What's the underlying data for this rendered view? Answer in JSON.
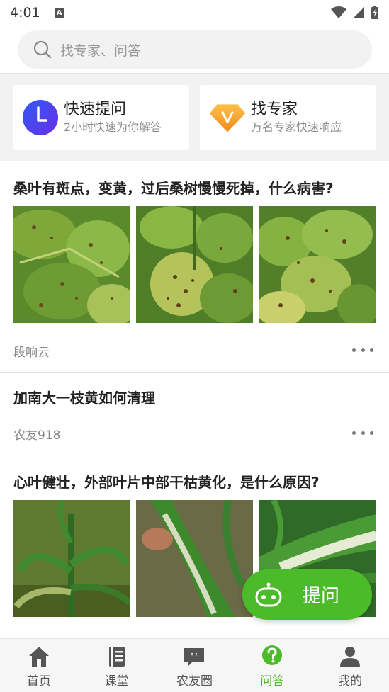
{
  "status_bar": {
    "time": "4:01",
    "notification": "A"
  },
  "search": {
    "placeholder": "找专家、问答"
  },
  "quick_actions": [
    {
      "title": "快速提问",
      "subtitle": "2小时快速为你解答",
      "icon": "clock-icon",
      "color": "#4a3ff0"
    },
    {
      "title": "找专家",
      "subtitle": "万名专家快速响应",
      "icon": "diamond-v-icon",
      "color": "#f5a623"
    }
  ],
  "posts": [
    {
      "title": "桑叶有斑点，变黄，过后桑树慢慢死掉，什么病害?",
      "author": "段响云",
      "image_count": 3,
      "images": [
        "mulberry-leaf-photo",
        "mulberry-leaf-photo",
        "mulberry-leaf-photo"
      ]
    },
    {
      "title": "加南大一枝黄如何清理",
      "author": "农友918",
      "image_count": 0
    },
    {
      "title": "心叶健壮，外部叶片中部干枯黄化，是什么原因?",
      "image_count": 3,
      "images": [
        "corn-plant-photo",
        "corn-leaf-photo",
        "corn-leaf-photo"
      ]
    }
  ],
  "ask_button": {
    "label": "提问",
    "icon": "robot-icon"
  },
  "tabs": [
    {
      "label": "首页",
      "icon": "home-icon",
      "active": false
    },
    {
      "label": "课堂",
      "icon": "book-icon",
      "active": false
    },
    {
      "label": "农友圈",
      "icon": "chat-bubble-icon",
      "active": false
    },
    {
      "label": "问答",
      "icon": "question-icon",
      "active": true
    },
    {
      "label": "我的",
      "icon": "user-icon",
      "active": false
    }
  ],
  "colors": {
    "accent": "#4cbb2a",
    "quick_ask": "#4a3ff0",
    "expert": "#f5a623"
  }
}
